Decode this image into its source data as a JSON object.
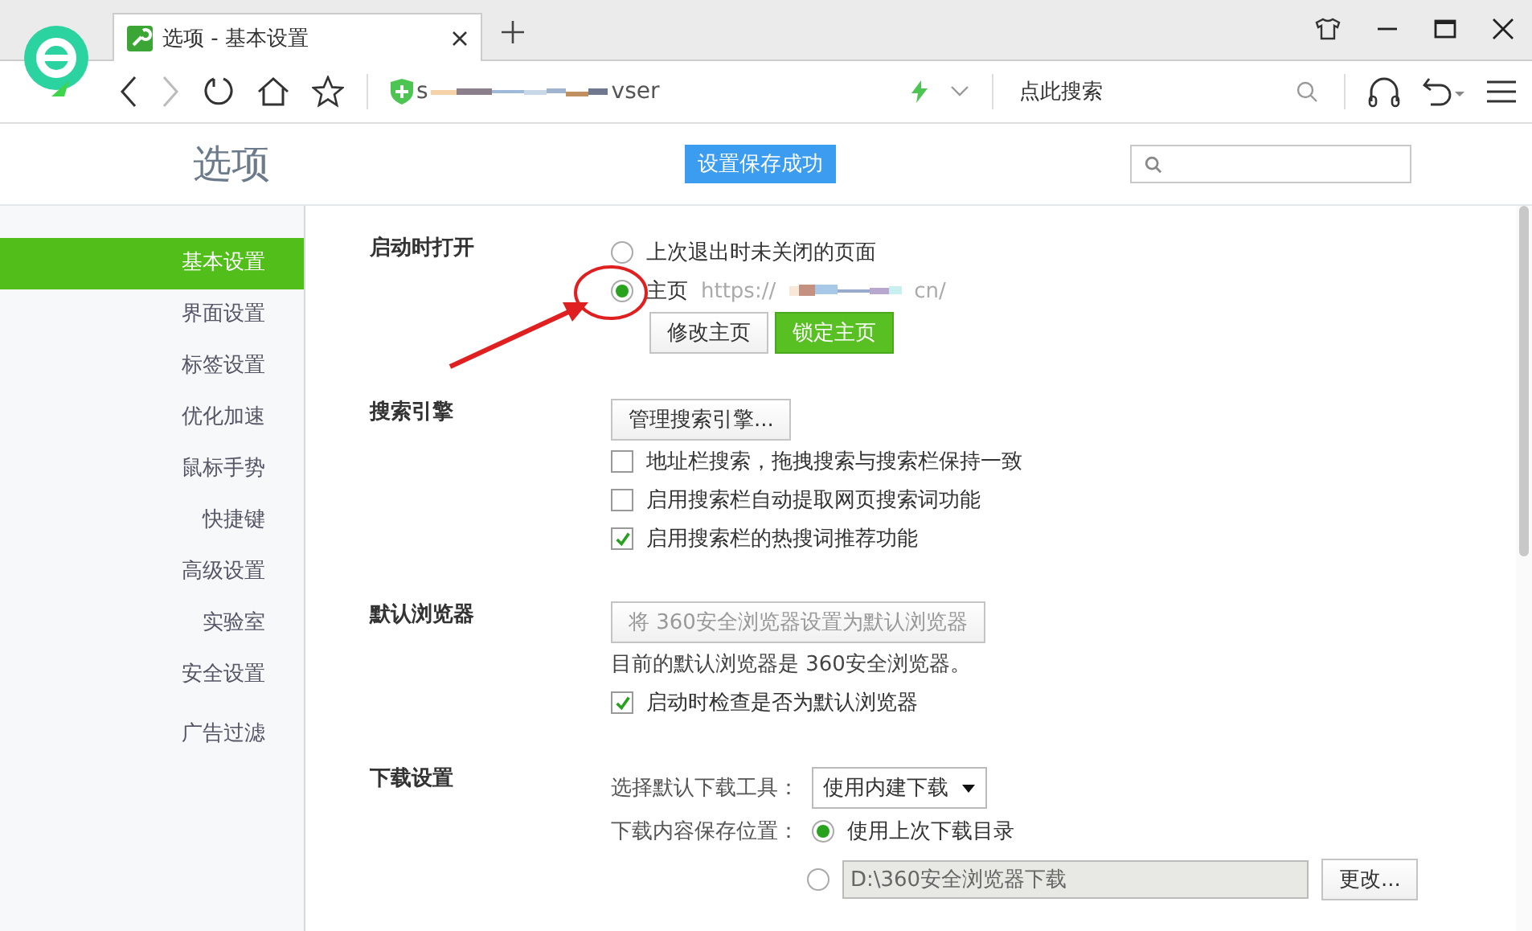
{
  "tab": {
    "title": "选项 - 基本设置",
    "selected": true
  },
  "address": {
    "start": "s",
    "end": "vser"
  },
  "search_box": {
    "placeholder": "点此搜索"
  },
  "page_title": "选项",
  "notice": "设置保存成功",
  "sidebar": {
    "items": [
      {
        "label": "基本设置",
        "selected": true
      },
      {
        "label": "界面设置",
        "selected": false
      },
      {
        "label": "标签设置",
        "selected": false
      },
      {
        "label": "优化加速",
        "selected": false
      },
      {
        "label": "鼠标手势",
        "selected": false
      },
      {
        "label": "快捷键",
        "selected": false
      },
      {
        "label": "高级设置",
        "selected": false
      },
      {
        "label": "实验室",
        "selected": false
      },
      {
        "label": "安全设置",
        "selected": false
      },
      {
        "label": "广告过滤",
        "selected": false
      }
    ]
  },
  "sections": [
    {
      "title": "启动时打开",
      "items": [
        {
          "kind": "radio",
          "label": "上次退出时未关闭的页面",
          "selected": false
        },
        {
          "kind": "radio",
          "label": "主页",
          "selected": true,
          "url_start": "https://",
          "url_end": "cn/"
        },
        {
          "kind": "buttons",
          "buttons": [
            {
              "label": "修改主页",
              "primary": false
            },
            {
              "label": "锁定主页",
              "primary": true
            }
          ]
        }
      ]
    },
    {
      "title": "搜索引擎",
      "items": [
        {
          "kind": "button",
          "label": "管理搜索引擎...",
          "disabled": false
        },
        {
          "kind": "checkbox",
          "label": "地址栏搜索，拖拽搜索与搜索栏保持一致",
          "checked": false
        },
        {
          "kind": "checkbox",
          "label": "启用搜索栏自动提取网页搜索词功能",
          "checked": false
        },
        {
          "kind": "checkbox",
          "label": "启用搜索栏的热搜词推荐功能",
          "checked": true
        }
      ]
    },
    {
      "title": "默认浏览器",
      "items": [
        {
          "kind": "button",
          "label": "将 360安全浏览器设置为默认浏览器",
          "disabled": true
        },
        {
          "kind": "note",
          "label": "目前的默认浏览器是 360安全浏览器。"
        },
        {
          "kind": "checkbox",
          "label": "启动时检查是否为默认浏览器",
          "checked": true
        }
      ]
    },
    {
      "title": "下载设置",
      "items": [
        {
          "kind": "select",
          "label": "选择默认下载工具：",
          "value": "使用内建下载"
        },
        {
          "kind": "labeled_radio",
          "label": "下载内容保存位置：",
          "option": "使用上次下载目录",
          "selected": true
        },
        {
          "kind": "path_radio",
          "selected": false,
          "path": "D:\\360安全浏览器下载",
          "button": "更改..."
        }
      ]
    }
  ]
}
